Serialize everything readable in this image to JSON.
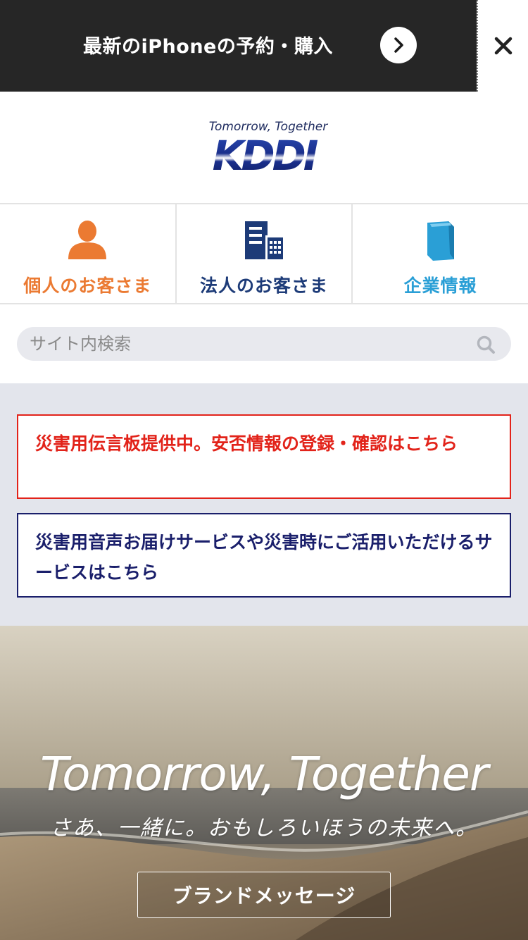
{
  "promo": {
    "text": "最新のiPhoneの予約・購入",
    "arrow_icon": "chevron-right-icon",
    "close_icon": "close-icon"
  },
  "logo": {
    "tagline": "Tomorrow, Together",
    "mark_text": "KDDI"
  },
  "nav": {
    "items": [
      {
        "label": "個人のお客さま",
        "icon": "person-icon",
        "color": "#eb7a32"
      },
      {
        "label": "法人のお客さま",
        "icon": "building-icon",
        "color": "#1d3b78"
      },
      {
        "label": "企業情報",
        "icon": "book-icon",
        "color": "#2a9fd6"
      }
    ]
  },
  "search": {
    "placeholder": "サイト内検索",
    "value": "",
    "icon": "search-icon"
  },
  "notices": {
    "red": "災害用伝言板提供中。安否情報の登録・確認はこちら",
    "navy": "災害用音声お届けサービスや災害時にご活用いただけるサービスはこちら"
  },
  "hero": {
    "title": "Tomorrow, Together",
    "subtitle": "さあ、一緒に。おもしろいほうの未来へ。",
    "button_label": "ブランドメッセージ"
  },
  "colors": {
    "promo_bg": "#262626",
    "notice_red": "#e2231a",
    "notice_navy": "#1a1f6b",
    "notice_area_bg": "#e3e5ec"
  }
}
